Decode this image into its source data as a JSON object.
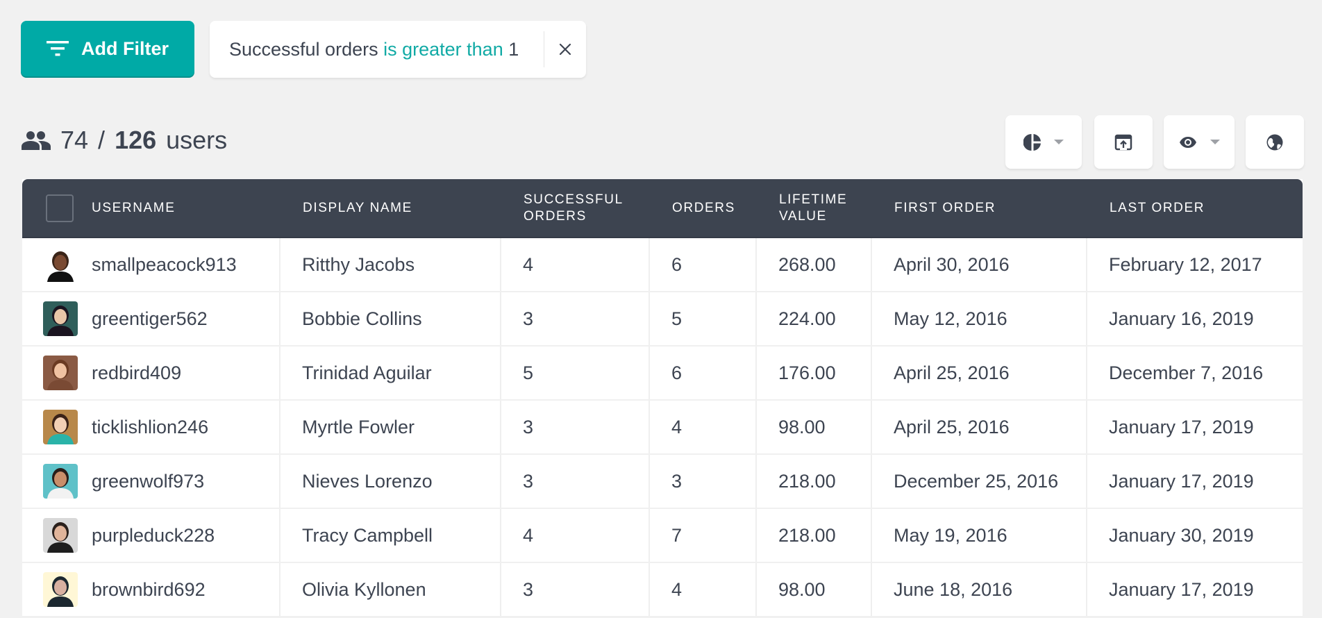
{
  "toolbar": {
    "add_filter_label": "Add Filter",
    "add_filter_icon": "filter-icon",
    "active_filter": {
      "field": "Successful orders",
      "operator": "is greater than",
      "value": "1",
      "remove_icon": "close-icon"
    }
  },
  "summary": {
    "icon": "users-icon",
    "shown": "74",
    "separator": "/",
    "total": "126",
    "unit": "users"
  },
  "actions": [
    {
      "name": "segments",
      "icon": "pie-chart-icon",
      "has_dropdown": true
    },
    {
      "name": "export",
      "icon": "export-icon",
      "has_dropdown": false
    },
    {
      "name": "columns",
      "icon": "eye-icon",
      "has_dropdown": true
    },
    {
      "name": "map",
      "icon": "globe-icon",
      "has_dropdown": false
    }
  ],
  "table": {
    "columns": [
      {
        "line1": "Username",
        "line2": ""
      },
      {
        "line1": "Display Name",
        "line2": ""
      },
      {
        "line1": "Successful",
        "line2": "Orders"
      },
      {
        "line1": "Orders",
        "line2": ""
      },
      {
        "line1": "Lifetime",
        "line2": "Value"
      },
      {
        "line1": "First Order",
        "line2": ""
      },
      {
        "line1": "Last Order",
        "line2": ""
      }
    ],
    "rows": [
      {
        "username": "smallpeacock913",
        "display_name": "Ritthy Jacobs",
        "successful_orders": "4",
        "orders": "6",
        "lifetime_value": "268.00",
        "first_order": "April 30, 2016",
        "last_order": "February 12, 2017"
      },
      {
        "username": "greentiger562",
        "display_name": "Bobbie Collins",
        "successful_orders": "3",
        "orders": "5",
        "lifetime_value": "224.00",
        "first_order": "May 12, 2016",
        "last_order": "January 16, 2019"
      },
      {
        "username": "redbird409",
        "display_name": "Trinidad Aguilar",
        "successful_orders": "5",
        "orders": "6",
        "lifetime_value": "176.00",
        "first_order": "April 25, 2016",
        "last_order": "December 7, 2016"
      },
      {
        "username": "ticklishlion246",
        "display_name": "Myrtle Fowler",
        "successful_orders": "3",
        "orders": "4",
        "lifetime_value": "98.00",
        "first_order": "April 25, 2016",
        "last_order": "January 17, 2019"
      },
      {
        "username": "greenwolf973",
        "display_name": "Nieves Lorenzo",
        "successful_orders": "3",
        "orders": "3",
        "lifetime_value": "218.00",
        "first_order": "December 25, 2016",
        "last_order": "January 17, 2019"
      },
      {
        "username": "purpleduck228",
        "display_name": "Tracy Campbell",
        "successful_orders": "4",
        "orders": "7",
        "lifetime_value": "218.00",
        "first_order": "May 19, 2016",
        "last_order": "January 30, 2019"
      },
      {
        "username": "brownbird692",
        "display_name": "Olivia Kyllonen",
        "successful_orders": "3",
        "orders": "4",
        "lifetime_value": "98.00",
        "first_order": "June 18, 2016",
        "last_order": "January 17, 2019"
      }
    ]
  },
  "colors": {
    "accent": "#00aaa6",
    "header_bg": "#3d4450",
    "text": "#3d4451",
    "page_bg": "#f1f1f1"
  }
}
